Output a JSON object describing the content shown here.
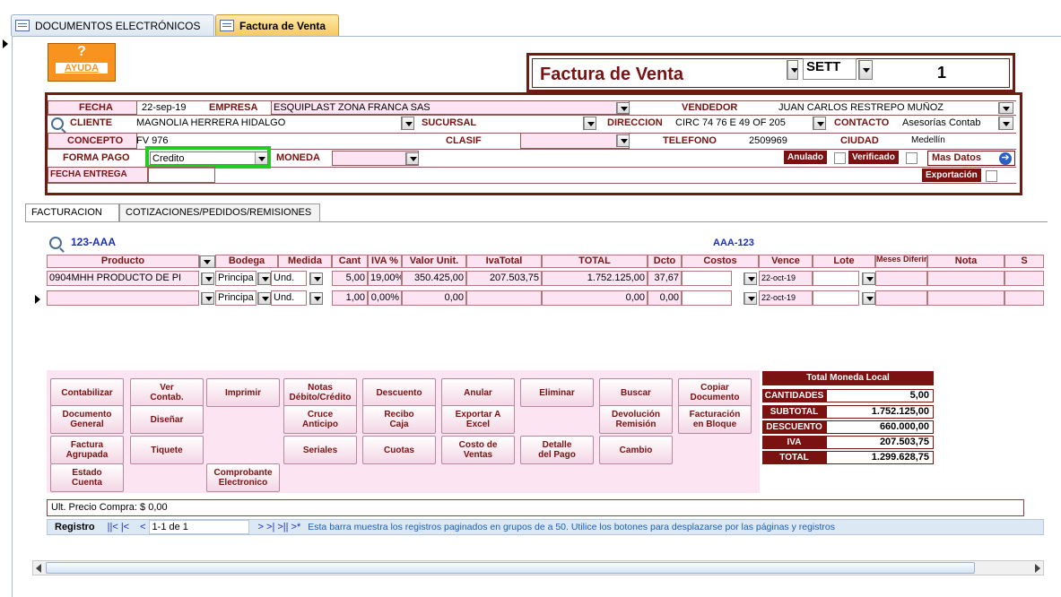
{
  "tabs": {
    "documents": "DOCUMENTOS ELECTRÓNICOS",
    "invoice": "Factura de Venta"
  },
  "header": {
    "help_q": "?",
    "help_label": "AYUDA",
    "form_title": "Factura de Venta",
    "series": "SETT",
    "number": "1"
  },
  "fields": {
    "fecha_label": "FECHA",
    "fecha": "22-sep-19",
    "empresa_label": "EMPRESA",
    "empresa": "ESQUIPLAST ZONA FRANCA SAS",
    "vendedor_label": "VENDEDOR",
    "vendedor": "JUAN CARLOS RESTREPO MUÑOZ",
    "cliente_label": "CLIENTE",
    "cliente": "MAGNOLIA HERRERA HIDALGO",
    "sucursal_label": "SUCURSAL",
    "direccion_label": "DIRECCION",
    "direccion": "CIRC 74 76 E 49 OF 205",
    "contacto_label": "CONTACTO",
    "contacto": "Asesorías Contab",
    "concepto_label": "CONCEPTO",
    "concepto": "FV 976",
    "clasif_label": "CLASIF",
    "telefono_label": "TELEFONO",
    "telefono": "2509969",
    "ciudad_label": "CIUDAD",
    "ciudad": "Medellín",
    "forma_pago_label": "FORMA PAGO",
    "forma_pago": "Credito",
    "moneda_label": "MONEDA",
    "anulado_label": "Anulado",
    "verificado_label": "Verificado",
    "mas_datos_label": "Mas Datos",
    "fecha_entrega_label": "FECHA ENTREGA",
    "exportacion_label": "Exportación"
  },
  "subtabs": {
    "facturacion": "FACTURACION",
    "cotizaciones": "COTIZACIONES/PEDIDOS/REMISIONES"
  },
  "grid": {
    "doc_code": "123-AAA",
    "ref_code": "AAA-123",
    "headers": [
      "Producto",
      "Bodega",
      "Medida",
      "Cant",
      "IVA %",
      "Valor Unit.",
      "IvaTotal",
      "TOTAL",
      "Dcto",
      "Costos",
      "Vence",
      "Lote",
      "Meses Diferir",
      "Nota",
      "S"
    ],
    "rows": [
      {
        "producto": "0904MHH PRODUCTO DE PI",
        "bodega": "Principa",
        "medida": "Und.",
        "cant": "5,00",
        "iva": "19,00%",
        "valor": "350.425,00",
        "ivatotal": "207.503,75",
        "total": "1.752.125,00",
        "dcto": "37,67",
        "costos": "",
        "vence": "22-oct-19"
      },
      {
        "producto": "",
        "bodega": "Principa",
        "medida": "Und.",
        "cant": "1,00",
        "iva": "0,00%",
        "valor": "0,00",
        "ivatotal": "",
        "total": "0,00",
        "dcto": "0,00",
        "costos": "",
        "vence": "22-oct-19"
      }
    ]
  },
  "buttons": {
    "contabilizar": "Contabilizar",
    "ver_contab": "Ver\nContab.",
    "imprimir": "Imprimir",
    "notas": "Notas\nDébito/Crédito",
    "descuento": "Descuento",
    "anular": "Anular",
    "eliminar": "Eliminar",
    "buscar": "Buscar",
    "copiar": "Copiar\nDocumento",
    "doc_general": "Documento\nGeneral",
    "disenar": "Diseñar",
    "cruce": "Cruce\nAnticipo",
    "recibo": "Recibo\nCaja",
    "exportar": "Exportar A\nExcel",
    "devolucion": "Devolución\nRemisión",
    "facturacion_bloque": "Facturación\nen Bloque",
    "factura_agrupada": "Factura\nAgrupada",
    "tiquete": "Tiquete",
    "seriales": "Seriales",
    "cuotas": "Cuotas",
    "costo_ventas": "Costo de\nVentas",
    "detalle_pago": "Detalle\ndel Pago",
    "cambio": "Cambio",
    "estado_cuenta": "Estado\nCuenta",
    "comprobante": "Comprobante\nElectronico"
  },
  "totals": {
    "title": "Total Moneda Local",
    "cantidades_label": "CANTIDADES",
    "cantidades": "5,00",
    "subtotal_label": "SUBTOTAL",
    "subtotal": "1.752.125,00",
    "descuento_label": "DESCUENTO",
    "descuento": "660.000,00",
    "iva_label": "IVA",
    "iva": "207.503,75",
    "total_label": "TOTAL",
    "total": "1.299.628,75"
  },
  "ult_precio": "Ult. Precio Compra: $ 0,00",
  "nav": {
    "registro": "Registro",
    "first_prev": "||< |<",
    "prev": "<",
    "page": "1-1 de 1",
    "next_buttons": ">  >|  >|| >*",
    "info": "Esta barra muestra los registros paginados en grupos de a 50.  Utilice los botones para desplazarse por las páginas y registros"
  },
  "colors": {
    "accent": "#7a1212",
    "highlight": "#22cc22",
    "link": "#1a2fb5",
    "help": "#f7931e"
  }
}
